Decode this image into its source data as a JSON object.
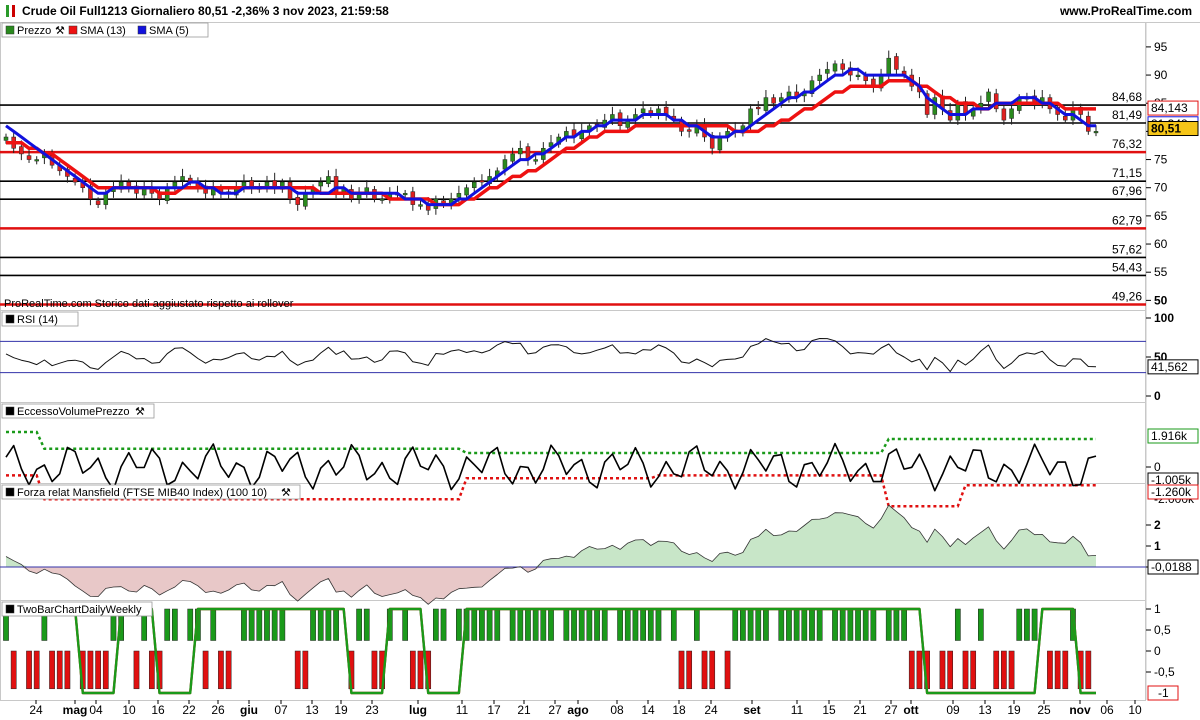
{
  "header": {
    "title": "Crude Oil Full1213 Giornaliero 80,51 -2,36% 3 nov 2023, 21:59:58",
    "site": "www.ProRealTime.com"
  },
  "colors": {
    "up": "#2a8a1e",
    "down": "#e02020",
    "sma13": "#ee1111",
    "sma5": "#1111dd",
    "volpos": "#1a9a1a",
    "volneg": "#e01010",
    "mansfield": "#c8e6c8",
    "mansfield_neg": "#e8c8c8"
  },
  "price_panel": {
    "legend": {
      "price": "Prezzo",
      "sma13": "SMA (13)",
      "sma5": "SMA (5)"
    },
    "axis_ticks": [
      "95",
      "90",
      "85",
      "80",
      "75",
      "70",
      "65",
      "60",
      "55",
      "50"
    ],
    "axis_values": [
      95,
      90,
      85,
      80,
      75,
      70,
      65,
      60,
      55,
      50
    ],
    "ylim": [
      49,
      98
    ],
    "watermark": "ProRealTime.com Storico dati aggiustato rispetto ai rollover",
    "levels": [
      {
        "label": "84,68",
        "value": 84.68,
        "color": "#000000"
      },
      {
        "label": "81,49",
        "value": 81.49,
        "color": "#000000"
      },
      {
        "label": "76,32",
        "value": 76.32,
        "color": "#e01010"
      },
      {
        "label": "71,15",
        "value": 71.15,
        "color": "#000000"
      },
      {
        "label": "67,96",
        "value": 67.96,
        "color": "#000000"
      },
      {
        "label": "62,79",
        "value": 62.79,
        "color": "#e01010"
      },
      {
        "label": "57,62",
        "value": 57.62,
        "color": "#000000"
      },
      {
        "label": "54,43",
        "value": 54.43,
        "color": "#000000"
      },
      {
        "label": "49,26",
        "value": 49.26,
        "color": "#e01010"
      }
    ],
    "badges": [
      {
        "label": "84,143",
        "value": 84.14,
        "color": "#e01010",
        "fill": "#ffffff"
      },
      {
        "label": "81,348",
        "value": 81.35,
        "color": "#1111dd",
        "fill": "#ffffff"
      },
      {
        "label": "80,51",
        "value": 80.51,
        "color": "#000000",
        "fill": "#f5c518"
      }
    ]
  },
  "rsi_panel": {
    "legend": "RSI (14)",
    "ticks": [
      "100",
      "50",
      "0"
    ],
    "current": "41,562"
  },
  "evp_panel": {
    "legend": "EccessoVolumePrezzo",
    "ticks": [
      "0",
      "-2.000k"
    ],
    "badges": [
      "1.916k",
      "-1.005k",
      "-1.260k"
    ]
  },
  "mansfield_panel": {
    "legend": "Forza relat Mansfield (FTSE MIB40 Index) (100 10)",
    "ticks": [
      "2",
      "1",
      "0"
    ],
    "current": "-0,0188"
  },
  "twobar_panel": {
    "legend": "TwoBarChartDailyWeekly",
    "ticks": [
      "1",
      "0,5",
      "0",
      "-0,5"
    ],
    "badge": "-1"
  },
  "x_axis": {
    "labels": [
      "24",
      "mag",
      "04",
      "10",
      "16",
      "22",
      "26",
      "giu",
      "07",
      "13",
      "19",
      "23",
      "lug",
      "11",
      "17",
      "21",
      "27",
      "ago",
      "08",
      "14",
      "18",
      "24",
      "set",
      "11",
      "15",
      "21",
      "27",
      "ott",
      "09",
      "13",
      "19",
      "25",
      "nov",
      "06",
      "10"
    ]
  },
  "chart_data": {
    "type": "candlestick",
    "title": "Crude Oil Full1213 Giornaliero",
    "x_range": [
      "2023-04-24",
      "2023-11-03"
    ],
    "close_last": 80.51,
    "change": "-2,36%",
    "close_series_approx": [
      79,
      77,
      76,
      75,
      75,
      76,
      74,
      73,
      72,
      71,
      70,
      68,
      67,
      69,
      70,
      71,
      70,
      69,
      70,
      69,
      68,
      70,
      71,
      72,
      71,
      70,
      69,
      70,
      69,
      69,
      70,
      71,
      70,
      70,
      71,
      70,
      71,
      68,
      67,
      69,
      70,
      71,
      72,
      69,
      70,
      68,
      69,
      70,
      68,
      68,
      69,
      69,
      69,
      67,
      67,
      66,
      68,
      67,
      68,
      69,
      70,
      71,
      71,
      72,
      73,
      75,
      76,
      77,
      75,
      75,
      77,
      78,
      79,
      80,
      79,
      80,
      81,
      81,
      82,
      83,
      81,
      82,
      83,
      84,
      83,
      84,
      83,
      82,
      80,
      80,
      81,
      79,
      77,
      79,
      80,
      80,
      81,
      84,
      84,
      86,
      85,
      86,
      87,
      86,
      87,
      89,
      90,
      91,
      92,
      91,
      90,
      90,
      89,
      88,
      90,
      93,
      91,
      90,
      88,
      87,
      83,
      86,
      84,
      82,
      85,
      83,
      84,
      85,
      87,
      84,
      82,
      84,
      86,
      86,
      85,
      86,
      84,
      83,
      82,
      84,
      83,
      80,
      80
    ],
    "sma13_approx": [
      78,
      78,
      78,
      77,
      77,
      76,
      76,
      75,
      74,
      73,
      72,
      71,
      70,
      70,
      70,
      70,
      70,
      70,
      70,
      70,
      69,
      69,
      69,
      70,
      70,
      70,
      70,
      70,
      70,
      70,
      70,
      70,
      70,
      70,
      70,
      70,
      70,
      70,
      70,
      70,
      70,
      69,
      69,
      69,
      69,
      69,
      69,
      69,
      69,
      69,
      68,
      68,
      68,
      68,
      68,
      68,
      67,
      67,
      67,
      67,
      68,
      68,
      69,
      70,
      70,
      71,
      72,
      72,
      73,
      73,
      74,
      75,
      76,
      77,
      77,
      78,
      79,
      79,
      80,
      80,
      80,
      80,
      81,
      81,
      81,
      81,
      81,
      81,
      81,
      81,
      81,
      81,
      81,
      81,
      81,
      80,
      80,
      80,
      80,
      81,
      81,
      82,
      82,
      83,
      84,
      84,
      85,
      86,
      87,
      87,
      88,
      88,
      88,
      88,
      88,
      89,
      89,
      89,
      89,
      88,
      88,
      87,
      86,
      86,
      85,
      85,
      85,
      84,
      84,
      85,
      85,
      85,
      85,
      85,
      85,
      85,
      85,
      85,
      84,
      84,
      84,
      84,
      84
    ],
    "sma5_approx": [
      81,
      80,
      79,
      78,
      77,
      76,
      75,
      74,
      73,
      72,
      71,
      70,
      69,
      69,
      70,
      70,
      70,
      70,
      70,
      70,
      70,
      70,
      70,
      70,
      71,
      71,
      70,
      70,
      69,
      69,
      69,
      70,
      70,
      70,
      70,
      70,
      70,
      70,
      69,
      69,
      69,
      69,
      69,
      70,
      70,
      69,
      69,
      69,
      69,
      69,
      69,
      69,
      68,
      68,
      68,
      67,
      67,
      67,
      67,
      68,
      68,
      69,
      70,
      71,
      72,
      73,
      74,
      75,
      75,
      76,
      76,
      77,
      78,
      79,
      79,
      80,
      80,
      81,
      81,
      82,
      82,
      82,
      82,
      83,
      83,
      83,
      83,
      82,
      82,
      81,
      81,
      80,
      79,
      79,
      79,
      80,
      80,
      81,
      82,
      83,
      84,
      85,
      86,
      86,
      87,
      87,
      88,
      89,
      90,
      90,
      91,
      91,
      90,
      90,
      90,
      90,
      90,
      90,
      89,
      88,
      86,
      85,
      84,
      83,
      83,
      83,
      84,
      84,
      84,
      85,
      85,
      85,
      86,
      86,
      86,
      85,
      85,
      84,
      83,
      83,
      82,
      81,
      81
    ]
  }
}
